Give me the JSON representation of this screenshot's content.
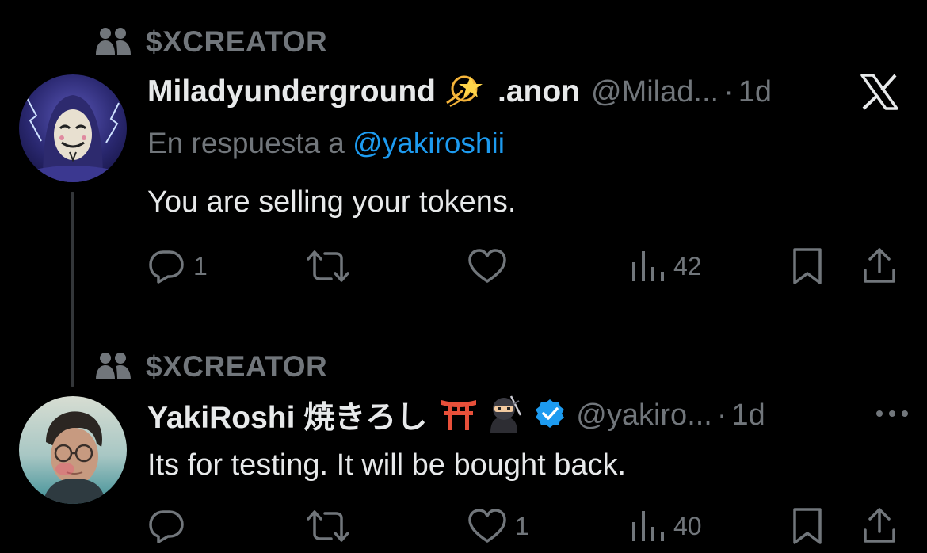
{
  "tweets": [
    {
      "community": "$XCREATOR",
      "display_name": "Miladyunderground",
      "display_name_emoji": "💫",
      "display_name_suffix": ".anon",
      "handle": "@Milad...",
      "separator": "·",
      "time": "1d",
      "reply_prefix": "En respuesta a",
      "reply_mention": "@yakiroshii",
      "text": "You are selling your tokens.",
      "counts": {
        "replies": "1",
        "reposts": "",
        "likes": "",
        "views": "42"
      },
      "corner_icon": "x-logo-icon"
    },
    {
      "community": "$XCREATOR",
      "display_name": "YakiRoshi 焼きろし",
      "display_name_emojis": [
        "⛩️",
        "🥷"
      ],
      "verified": true,
      "handle": "@yakiro...",
      "separator": "·",
      "time": "1d",
      "text": "Its for testing. It will be bought back.",
      "counts": {
        "replies": "",
        "reposts": "",
        "likes": "1",
        "views": "40"
      },
      "corner_icon": "more-icon"
    }
  ],
  "colors": {
    "background": "#000000",
    "primary_text": "#e7e9ea",
    "secondary_text": "#71767b",
    "link": "#1d9bf0",
    "verified_badge": "#1d9bf0",
    "thread_line": "#333639"
  }
}
